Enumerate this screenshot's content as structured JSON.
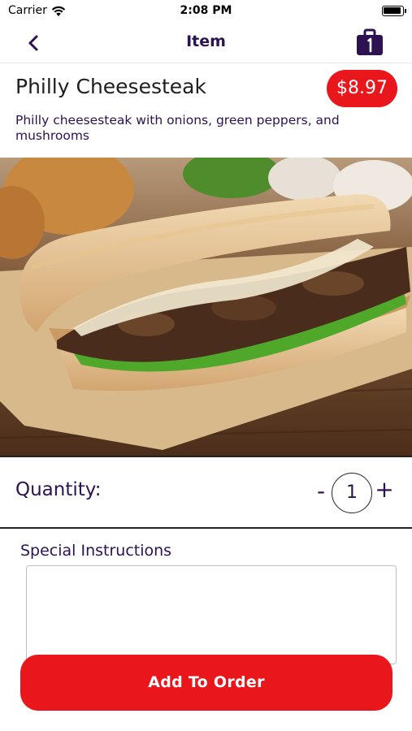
{
  "status_bar": {
    "carrier": "Carrier",
    "time": "2:08 PM",
    "wifi_icon": "wifi-icon",
    "battery_icon": "battery-icon"
  },
  "nav": {
    "title": "Item",
    "back_icon": "chevron-left-icon",
    "bag_icon": "shopping-bag-icon"
  },
  "item": {
    "name": "Philly Cheesesteak",
    "price": "$8.97",
    "description": "Philly cheesesteak with onions, green peppers, and mushrooms",
    "image": "philly-cheesesteak-photo"
  },
  "quantity": {
    "label": "Quantity:",
    "minus": "-",
    "value": "1",
    "plus": "+"
  },
  "special_instructions": {
    "label": "Special Instructions",
    "value": "",
    "placeholder": ""
  },
  "add_button": {
    "label": "Add To Order"
  },
  "colors": {
    "brand_purple": "#2c1250",
    "accent_red": "#e9161b"
  }
}
